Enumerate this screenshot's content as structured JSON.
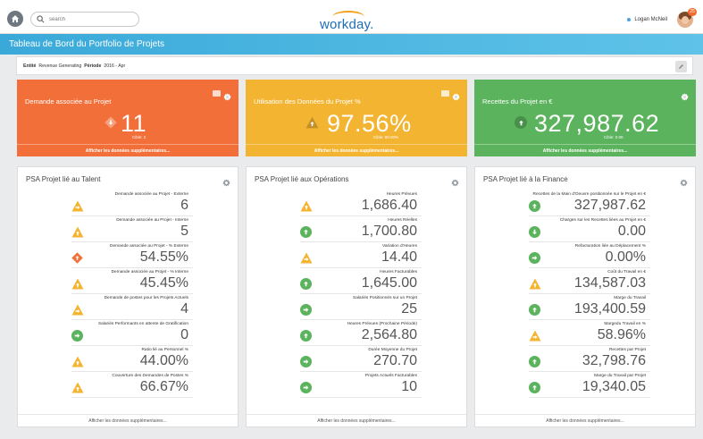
{
  "topbar": {
    "search_placeholder": "search",
    "logo_text": "workday.",
    "user_name": "Logan McNeil",
    "notification_count": "25"
  },
  "banner": {
    "title": "Tableau de Bord du Portfolio de Projets"
  },
  "filters": {
    "entity_label": "Entité",
    "entity_value": "Revenue Generating",
    "period_label": "Période",
    "period_value": "2016 - Apr"
  },
  "kpis": [
    {
      "title": "Demande associée au Projet",
      "value": "11",
      "cible": "Cible: 2",
      "footer": "Afficher les données supplémentaires...",
      "color": "#f36f3a",
      "icon": "arrow-down-diamond-icon"
    },
    {
      "title": "Utilisation des Données du Projet %",
      "value": "97.56%",
      "cible": "Cible: 80.00%",
      "footer": "Afficher les données supplémentaires...",
      "color": "#f3b431",
      "icon": "arrow-up-triangle-icon"
    },
    {
      "title": "Recettes du Projet en €",
      "value": "327,987.62",
      "cible": "Cible: 0.00",
      "footer": "Afficher les données supplémentaires...",
      "color": "#5bb45d",
      "icon": "arrow-up-circle-icon"
    }
  ],
  "panels": [
    {
      "title": "PSA Projet lié au Talent",
      "footer": "Afficher les données supplémentaires...",
      "rows": [
        {
          "label": "Demande associée au Projet - Externe",
          "value": "6",
          "icon": "tri-right"
        },
        {
          "label": "Demande associée au Projet - Interne",
          "value": "5",
          "icon": "tri-up"
        },
        {
          "label": "Demande associée au Projet - % Externe",
          "value": "54.55%",
          "icon": "dia-up"
        },
        {
          "label": "Demande associée au Projet - % Interne",
          "value": "45.45%",
          "icon": "tri-up"
        },
        {
          "label": "Demande de postes pour les Projets Actuels",
          "value": "4",
          "icon": "tri-right"
        },
        {
          "label": "Salariés Performants en attente de Gratification",
          "value": "0",
          "icon": "circ-right"
        },
        {
          "label": "Ratio lié au Personnel %",
          "value": "44.00%",
          "icon": "tri-up"
        },
        {
          "label": "Couverture des Demandes de Postes %",
          "value": "66.67%",
          "icon": "tri-up"
        }
      ]
    },
    {
      "title": "PSA Projet lié aux Opérations",
      "footer": "Afficher les données supplémentaires...",
      "rows": [
        {
          "label": "Heures Prévues",
          "value": "1,686.40",
          "icon": "tri-up"
        },
        {
          "label": "Heures Réelles",
          "value": "1,700.80",
          "icon": "circ-up"
        },
        {
          "label": "Variation d'Heures",
          "value": "14.40",
          "icon": "tri-right"
        },
        {
          "label": "Heures Facturables",
          "value": "1,645.00",
          "icon": "circ-up"
        },
        {
          "label": "Salariés Positionnés sur un Projet",
          "value": "25",
          "icon": "circ-right"
        },
        {
          "label": "Heures Prévues (Prochaine Période)",
          "value": "2,564.80",
          "icon": "circ-up"
        },
        {
          "label": "Durée Moyenne du Projet",
          "value": "270.70",
          "icon": "circ-right"
        },
        {
          "label": "Projets Actuels Facturables",
          "value": "10",
          "icon": "circ-right"
        }
      ]
    },
    {
      "title": "PSA Projet lié à la Finance",
      "footer": "Afficher les données supplémentaires...",
      "rows": [
        {
          "label": "Recettes de la Main d'Oeuvre positionnée sur le Projet en €",
          "value": "327,987.62",
          "icon": "circ-up"
        },
        {
          "label": "Charges sur les Recettes liées au Projet en €",
          "value": "0.00",
          "icon": "circ-down"
        },
        {
          "label": "Refacturation liée au Déplacement %",
          "value": "0.00%",
          "icon": "circ-right"
        },
        {
          "label": "Coût du Travail en €",
          "value": "134,587.03",
          "icon": "tri-up"
        },
        {
          "label": "Marge du Travail",
          "value": "193,400.59",
          "icon": "circ-up"
        },
        {
          "label": "Margedu Travail en %",
          "value": "58.96%",
          "icon": "tri-right"
        },
        {
          "label": "Recettes par Projet",
          "value": "32,798.76",
          "icon": "circ-up"
        },
        {
          "label": "Marge du Travail par Projet",
          "value": "19,340.05",
          "icon": "circ-up"
        }
      ]
    }
  ],
  "colors": {
    "orange": "#f36f3a",
    "yellow": "#f3b431",
    "green": "#5bb45d",
    "banner": "#3aa9d9",
    "logo_blue": "#1f6db5"
  }
}
